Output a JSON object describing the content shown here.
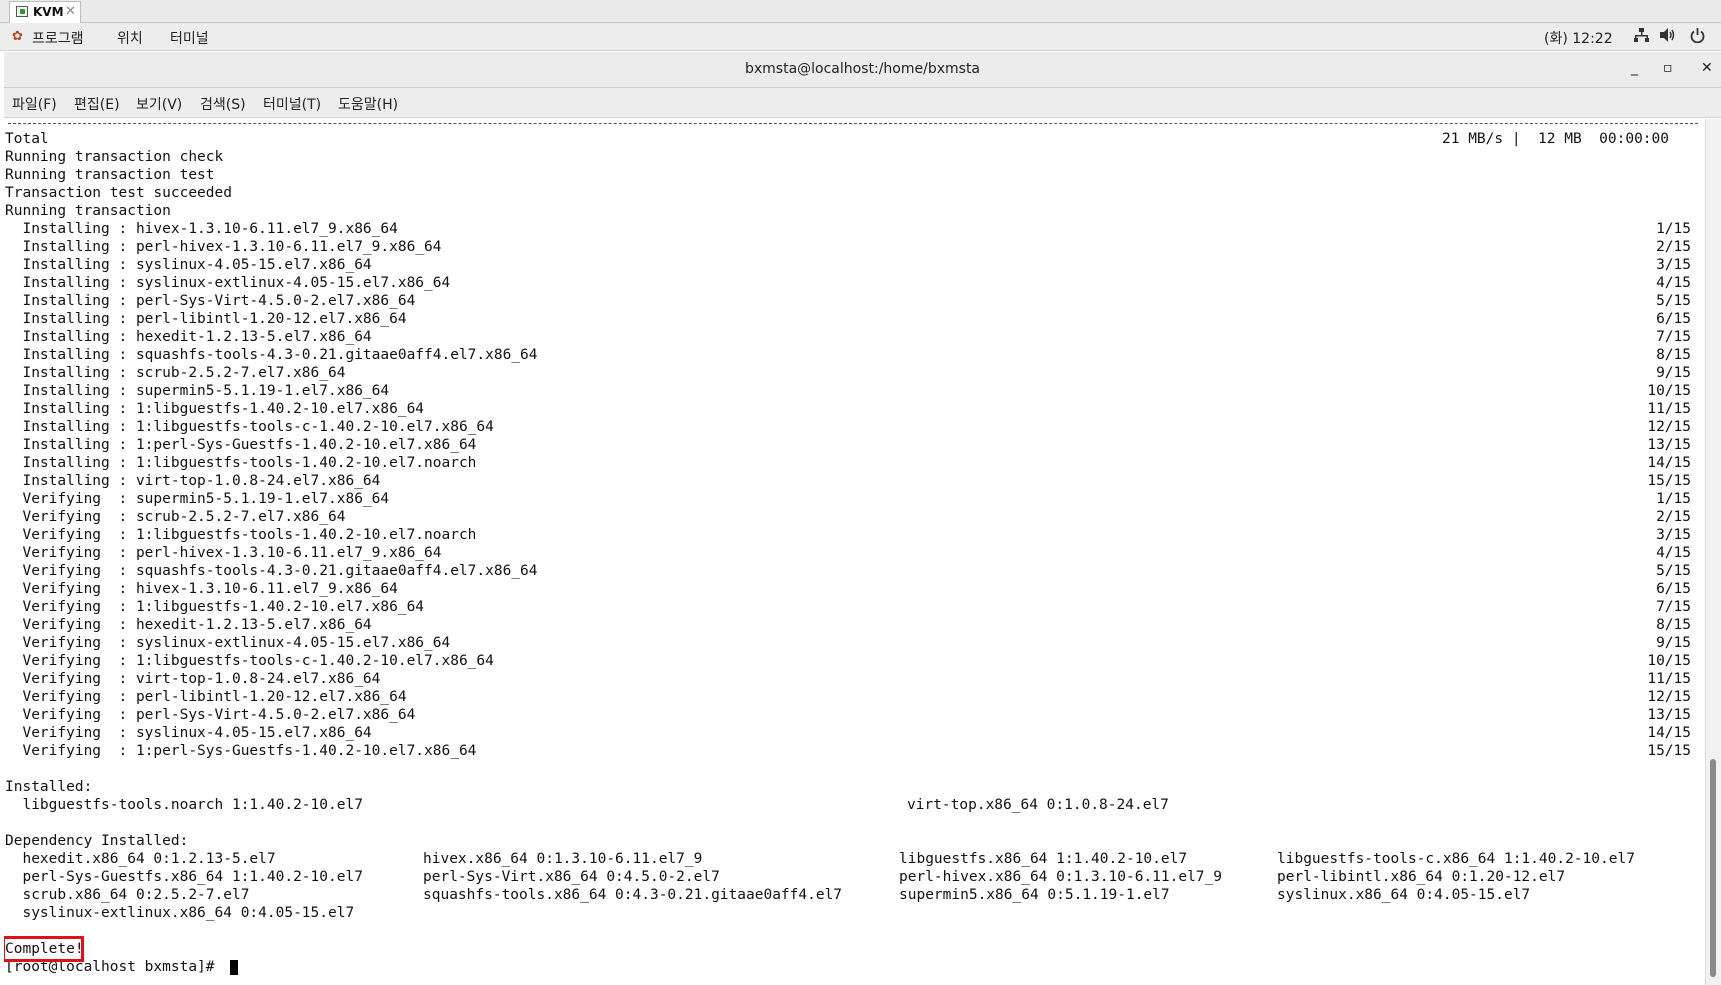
{
  "kvm": {
    "tab_title": "KVM",
    "tab_close": "✕"
  },
  "topbar": {
    "app_icon": "✿",
    "menus": [
      "프로그램",
      "위치",
      "터미널"
    ],
    "clock": "(화) 12:22",
    "icons": [
      "network-icon",
      "volume-icon",
      "power-icon"
    ]
  },
  "window": {
    "title": "bxmsta@localhost:/home/bxmsta",
    "buttons": {
      "minimize": "_",
      "maximize": "▫",
      "close": "✕"
    },
    "menus": [
      "파일(F)",
      "편집(E)",
      "보기(V)",
      "검색(S)",
      "터미널(T)",
      "도움말(H)"
    ]
  },
  "terminal": {
    "total_line": "Total",
    "total_stats": "21 MB/s |  12 MB  00:00:00",
    "header_lines": [
      "Running transaction check",
      "Running transaction test",
      "Transaction test succeeded",
      "Running transaction"
    ],
    "steps": [
      {
        "text": "  Installing : hivex-1.3.10-6.11.el7_9.x86_64",
        "count": "1/15"
      },
      {
        "text": "  Installing : perl-hivex-1.3.10-6.11.el7_9.x86_64",
        "count": "2/15"
      },
      {
        "text": "  Installing : syslinux-4.05-15.el7.x86_64",
        "count": "3/15"
      },
      {
        "text": "  Installing : syslinux-extlinux-4.05-15.el7.x86_64",
        "count": "4/15"
      },
      {
        "text": "  Installing : perl-Sys-Virt-4.5.0-2.el7.x86_64",
        "count": "5/15"
      },
      {
        "text": "  Installing : perl-libintl-1.20-12.el7.x86_64",
        "count": "6/15"
      },
      {
        "text": "  Installing : hexedit-1.2.13-5.el7.x86_64",
        "count": "7/15"
      },
      {
        "text": "  Installing : squashfs-tools-4.3-0.21.gitaae0aff4.el7.x86_64",
        "count": "8/15"
      },
      {
        "text": "  Installing : scrub-2.5.2-7.el7.x86_64",
        "count": "9/15"
      },
      {
        "text": "  Installing : supermin5-5.1.19-1.el7.x86_64",
        "count": "10/15"
      },
      {
        "text": "  Installing : 1:libguestfs-1.40.2-10.el7.x86_64",
        "count": "11/15"
      },
      {
        "text": "  Installing : 1:libguestfs-tools-c-1.40.2-10.el7.x86_64",
        "count": "12/15"
      },
      {
        "text": "  Installing : 1:perl-Sys-Guestfs-1.40.2-10.el7.x86_64",
        "count": "13/15"
      },
      {
        "text": "  Installing : 1:libguestfs-tools-1.40.2-10.el7.noarch",
        "count": "14/15"
      },
      {
        "text": "  Installing : virt-top-1.0.8-24.el7.x86_64",
        "count": "15/15"
      },
      {
        "text": "  Verifying  : supermin5-5.1.19-1.el7.x86_64",
        "count": "1/15"
      },
      {
        "text": "  Verifying  : scrub-2.5.2-7.el7.x86_64",
        "count": "2/15"
      },
      {
        "text": "  Verifying  : 1:libguestfs-tools-1.40.2-10.el7.noarch",
        "count": "3/15"
      },
      {
        "text": "  Verifying  : perl-hivex-1.3.10-6.11.el7_9.x86_64",
        "count": "4/15"
      },
      {
        "text": "  Verifying  : squashfs-tools-4.3-0.21.gitaae0aff4.el7.x86_64",
        "count": "5/15"
      },
      {
        "text": "  Verifying  : hivex-1.3.10-6.11.el7_9.x86_64",
        "count": "6/15"
      },
      {
        "text": "  Verifying  : 1:libguestfs-1.40.2-10.el7.x86_64",
        "count": "7/15"
      },
      {
        "text": "  Verifying  : hexedit-1.2.13-5.el7.x86_64",
        "count": "8/15"
      },
      {
        "text": "  Verifying  : syslinux-extlinux-4.05-15.el7.x86_64",
        "count": "9/15"
      },
      {
        "text": "  Verifying  : 1:libguestfs-tools-c-1.40.2-10.el7.x86_64",
        "count": "10/15"
      },
      {
        "text": "  Verifying  : virt-top-1.0.8-24.el7.x86_64",
        "count": "11/15"
      },
      {
        "text": "  Verifying  : perl-libintl-1.20-12.el7.x86_64",
        "count": "12/15"
      },
      {
        "text": "  Verifying  : perl-Sys-Virt-4.5.0-2.el7.x86_64",
        "count": "13/15"
      },
      {
        "text": "  Verifying  : syslinux-4.05-15.el7.x86_64",
        "count": "14/15"
      },
      {
        "text": "  Verifying  : 1:perl-Sys-Guestfs-1.40.2-10.el7.x86_64",
        "count": "15/15"
      }
    ],
    "installed_heading": "Installed:",
    "installed": [
      "  libguestfs-tools.noarch 1:1.40.2-10.el7",
      "virt-top.x86_64 0:1.0.8-24.el7"
    ],
    "dependency_heading": "Dependency Installed:",
    "dependencies": [
      [
        "  hexedit.x86_64 0:1.2.13-5.el7",
        "hivex.x86_64 0:1.3.10-6.11.el7_9",
        "libguestfs.x86_64 1:1.40.2-10.el7",
        "libguestfs-tools-c.x86_64 1:1.40.2-10.el7"
      ],
      [
        "  perl-Sys-Guestfs.x86_64 1:1.40.2-10.el7",
        "perl-Sys-Virt.x86_64 0:4.5.0-2.el7",
        "perl-hivex.x86_64 0:1.3.10-6.11.el7_9",
        "perl-libintl.x86_64 0:1.20-12.el7"
      ],
      [
        "  scrub.x86_64 0:2.5.2-7.el7",
        "squashfs-tools.x86_64 0:4.3-0.21.gitaae0aff4.el7",
        "supermin5.x86_64 0:5.1.19-1.el7",
        "syslinux.x86_64 0:4.05-15.el7"
      ],
      [
        "  syslinux-extlinux.x86_64 0:4.05-15.el7"
      ]
    ],
    "complete": "Complete!",
    "prompt": "[root@localhost bxmsta]# "
  }
}
